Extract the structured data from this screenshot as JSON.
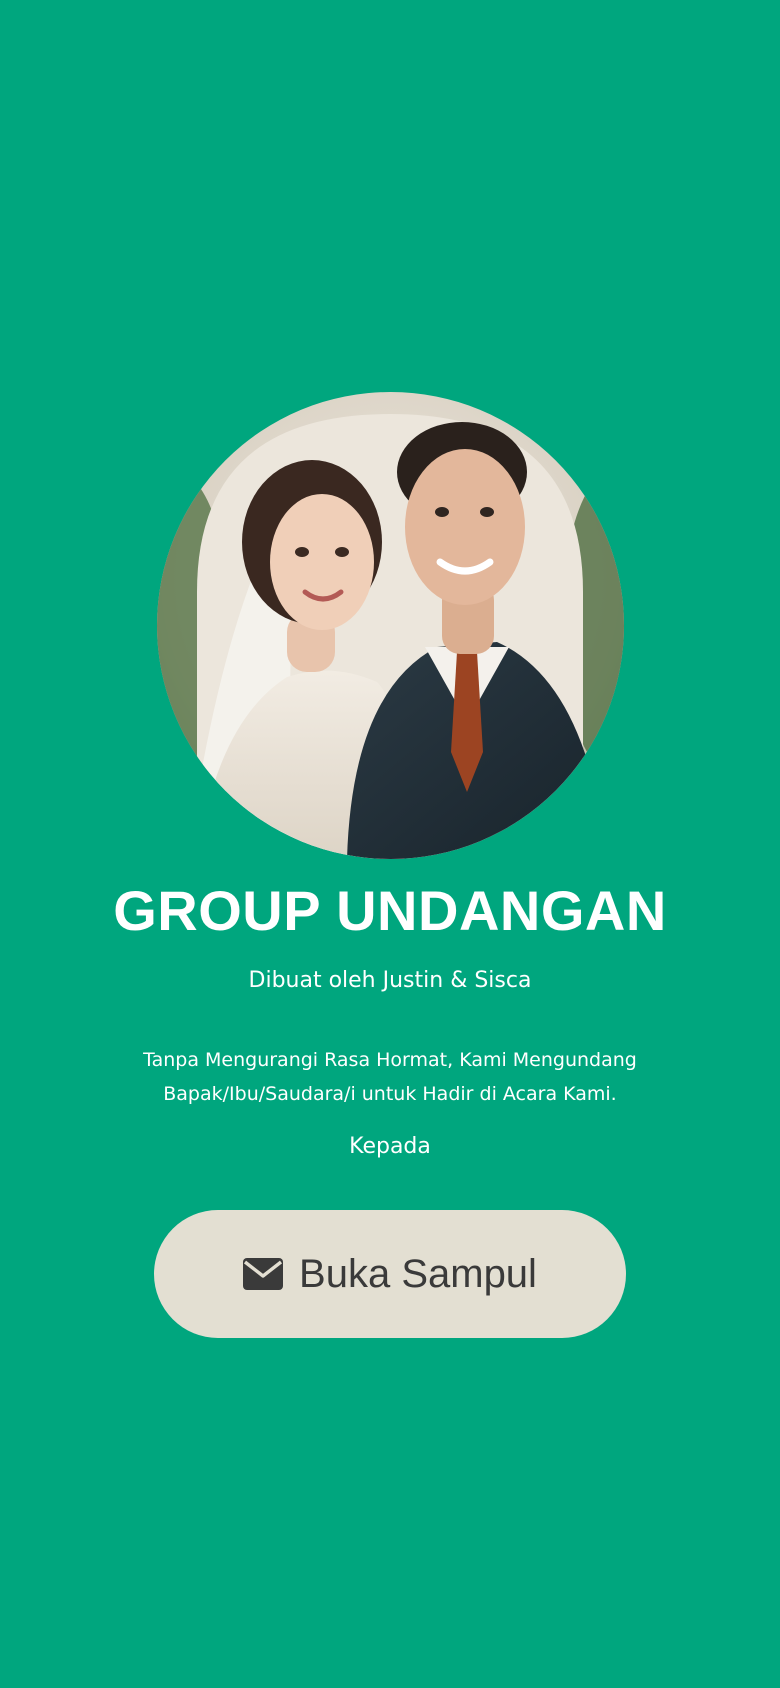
{
  "colors": {
    "background": "#00A67E",
    "button_background": "#E3DFD2",
    "button_text": "#3A3A3A",
    "text": "#FFFFFF"
  },
  "cover": {
    "photo_icon": "couple-photo",
    "title": "GROUP UNDANGAN",
    "subtitle": "Dibuat oleh Justin & Sisca",
    "message": "Tanpa Mengurangi Rasa Hormat, Kami Mengundang Bapak/Ibu/Saudara/i untuk Hadir di Acara Kami.",
    "recipient_label": "Kepada",
    "open_button": {
      "icon": "envelope-icon",
      "label": "Buka Sampul"
    }
  }
}
